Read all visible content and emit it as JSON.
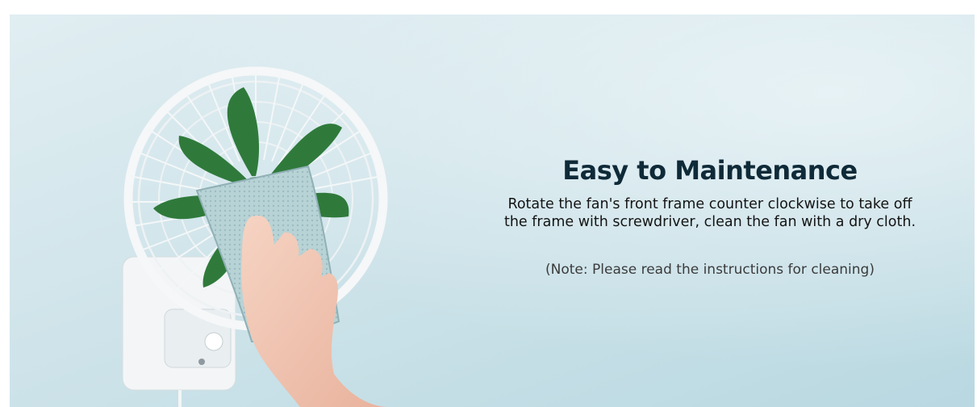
{
  "banner": {
    "title": "Easy to Maintenance",
    "description": "Rotate the fan's front frame counter clockwise to take off the frame with screwdriver, clean the fan with a dry cloth.",
    "note": "(Note: Please read the instructions for cleaning)"
  },
  "colors": {
    "background": "#cfe4ea",
    "blade": "#2f7a3b",
    "title": "#0f2a38"
  }
}
